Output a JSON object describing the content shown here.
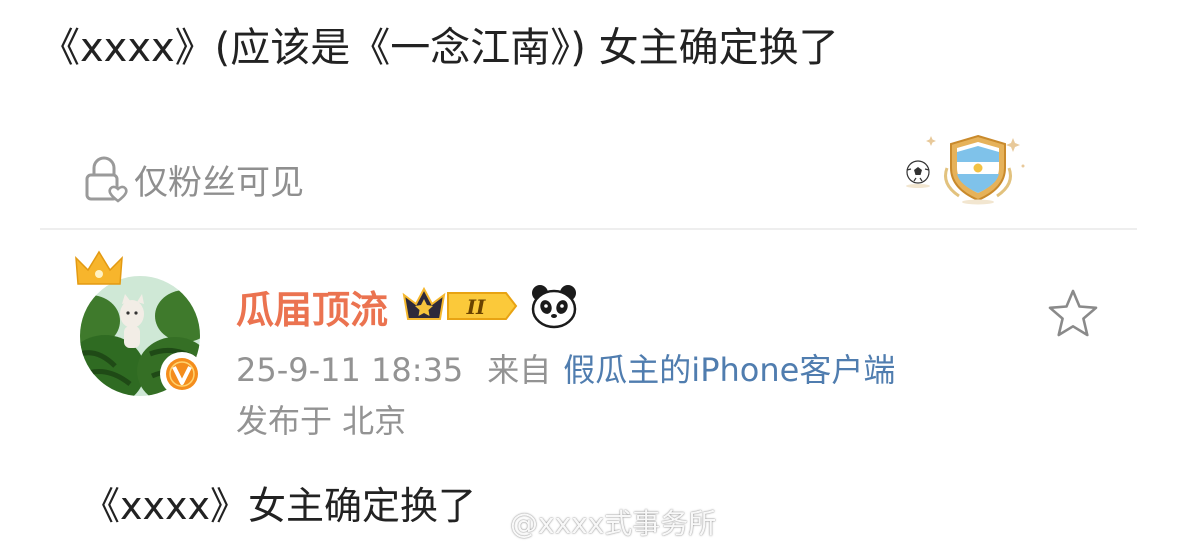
{
  "headline": "《xxxx》(应该是《一念江南》) 女主确定换了",
  "visibility": {
    "icon": "lock-heart-icon",
    "label": "仅粉丝可见"
  },
  "decoration": {
    "icon": "argentina-shield-badge-icon"
  },
  "post": {
    "author": {
      "name": "瓜届顶流",
      "level": "II",
      "avatar_icon": "watermelon-cat-avatar",
      "verified_icon": "orange-v-icon",
      "crown_icon": "crown-icon",
      "emoji_icon": "panda-icon"
    },
    "favorite_icon": "star-icon",
    "time": "25-9-11 18:35",
    "from_label": "来自",
    "source": "假瓜主的iPhone客户端",
    "location": "发布于 北京",
    "text": "《xxxx》女主确定换了"
  },
  "watermark": {
    "text": "@xxxx式事务所",
    "icon": "weibo-logo-icon"
  },
  "colors": {
    "accent_orange": "#eb7350",
    "link_blue": "#507daf",
    "meta_gray": "#939393",
    "text_dark": "#222222",
    "divider": "#eeeeee"
  }
}
